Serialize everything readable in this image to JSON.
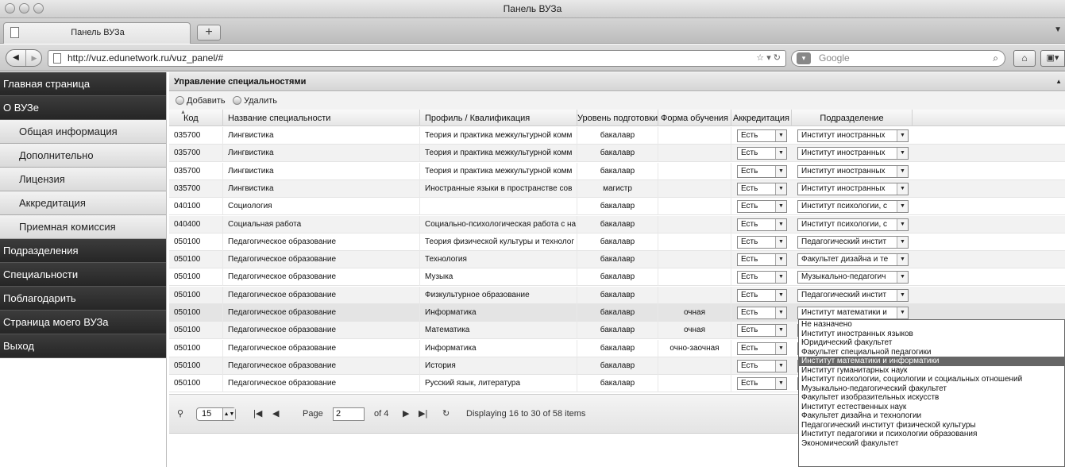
{
  "window": {
    "title": "Панель ВУЗа"
  },
  "browser": {
    "tab_label": "Панель ВУЗа",
    "new_tab": "+",
    "url": "http://vuz.edunetwork.ru/vuz_panel/#",
    "search_placeholder": "Google"
  },
  "sidebar": {
    "items": [
      {
        "label": "Главная страница",
        "kind": "top"
      },
      {
        "label": "О ВУЗе",
        "kind": "top"
      },
      {
        "label": "Общая информация",
        "kind": "sub"
      },
      {
        "label": "Дополнительно",
        "kind": "sub"
      },
      {
        "label": "Лицензия",
        "kind": "sub"
      },
      {
        "label": "Аккредитация",
        "kind": "sub"
      },
      {
        "label": "Приемная комиссия",
        "kind": "sub"
      },
      {
        "label": "Подразделения",
        "kind": "top"
      },
      {
        "label": "Специальности",
        "kind": "top"
      },
      {
        "label": "Поблагодарить",
        "kind": "top"
      },
      {
        "label": "Страница моего ВУЗа",
        "kind": "top"
      },
      {
        "label": "Выход",
        "kind": "top"
      }
    ]
  },
  "panel": {
    "title": "Управление специальностями",
    "add_label": "Добавить",
    "delete_label": "Удалить"
  },
  "table": {
    "columns": [
      "Код",
      "Название специальности",
      "Профиль / Квалификация",
      "Уровень подготовки",
      "Форма обучения",
      "Аккредитация",
      "Подразделение"
    ],
    "rows": [
      {
        "code": "035700",
        "name": "Лингвистика",
        "profile": "Теория и практика межкультурной комм",
        "level": "бакалавр",
        "form": "",
        "accr": "Есть",
        "dept": "Институт иностранных"
      },
      {
        "code": "035700",
        "name": "Лингвистика",
        "profile": "Теория и практика межкультурной комм",
        "level": "бакалавр",
        "form": "",
        "accr": "Есть",
        "dept": "Институт иностранных"
      },
      {
        "code": "035700",
        "name": "Лингвистика",
        "profile": "Теория и практика межкультурной комм",
        "level": "бакалавр",
        "form": "",
        "accr": "Есть",
        "dept": "Институт иностранных"
      },
      {
        "code": "035700",
        "name": "Лингвистика",
        "profile": "Иностранные языки в пространстве сов",
        "level": "магистр",
        "form": "",
        "accr": "Есть",
        "dept": "Институт иностранных"
      },
      {
        "code": "040100",
        "name": "Социология",
        "profile": "",
        "level": "бакалавр",
        "form": "",
        "accr": "Есть",
        "dept": "Институт психологии, с"
      },
      {
        "code": "040400",
        "name": "Социальная работа",
        "profile": "Социально-психологическая работа с на",
        "level": "бакалавр",
        "form": "",
        "accr": "Есть",
        "dept": "Институт психологии, с"
      },
      {
        "code": "050100",
        "name": "Педагогическое образование",
        "profile": "Теория физической культуры и технолог",
        "level": "бакалавр",
        "form": "",
        "accr": "Есть",
        "dept": "Педагогический инстит"
      },
      {
        "code": "050100",
        "name": "Педагогическое образование",
        "profile": "Технология",
        "level": "бакалавр",
        "form": "",
        "accr": "Есть",
        "dept": "Факультет дизайна и те"
      },
      {
        "code": "050100",
        "name": "Педагогическое образование",
        "profile": "Музыка",
        "level": "бакалавр",
        "form": "",
        "accr": "Есть",
        "dept": "Музыкально-педагогич"
      },
      {
        "code": "050100",
        "name": "Педагогическое образование",
        "profile": "Физкультурное образование",
        "level": "бакалавр",
        "form": "",
        "accr": "Есть",
        "dept": "Педагогический инстит"
      },
      {
        "code": "050100",
        "name": "Педагогическое образование",
        "profile": "Информатика",
        "level": "бакалавр",
        "form": "очная",
        "accr": "Есть",
        "dept": "Институт математики и"
      },
      {
        "code": "050100",
        "name": "Педагогическое образование",
        "profile": "Математика",
        "level": "бакалавр",
        "form": "очная",
        "accr": "Есть",
        "dept": ""
      },
      {
        "code": "050100",
        "name": "Педагогическое образование",
        "profile": "Информатика",
        "level": "бакалавр",
        "form": "очно-заочная",
        "accr": "Есть",
        "dept": ""
      },
      {
        "code": "050100",
        "name": "Педагогическое образование",
        "profile": "История",
        "level": "бакалавр",
        "form": "",
        "accr": "Есть",
        "dept": ""
      },
      {
        "code": "050100",
        "name": "Педагогическое образование",
        "profile": "Русский язык, литература",
        "level": "бакалавр",
        "form": "",
        "accr": "Есть",
        "dept": ""
      }
    ]
  },
  "pager": {
    "page_size": "15",
    "page_label": "Page",
    "page_value": "2",
    "of_label": "of 4",
    "display_text": "Displaying 16 to 30 of 58 items"
  },
  "dropdown": {
    "options": [
      "Не назначено",
      "Институт иностранных языков",
      "Юридический факультет",
      "Факультет специальной педагогики",
      "Институт математики и информатики",
      "Институт гуманитарных наук",
      "Институт психологии, социологии и социальных отношений",
      "Музыкально-педагогический факультет",
      "Факультет изобразительных искусств",
      "Институт естественных наук",
      "Факультет дизайна и технологии",
      "Педагогический институт физической культуры",
      "Институт педагогики и психологии образования",
      "Экономический факультет"
    ],
    "highlighted": "Институт математики и информатики"
  },
  "colors": {
    "sidebar_dark": "#2e2e2e",
    "highlight": "#666666"
  }
}
